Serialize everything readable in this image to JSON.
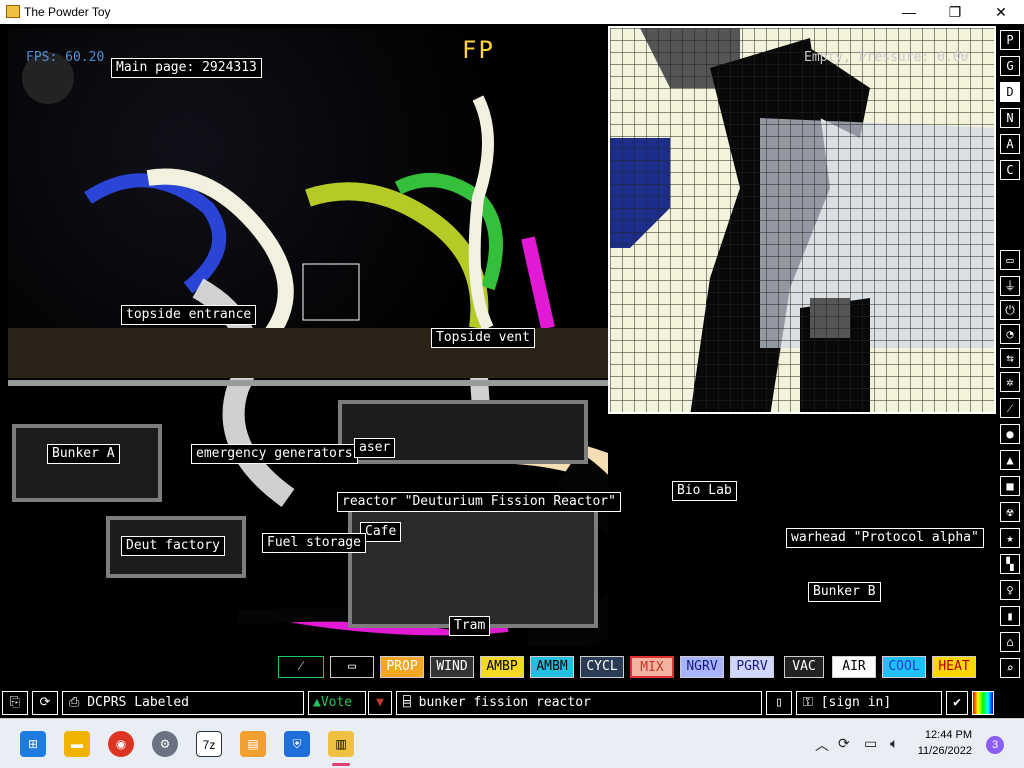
{
  "window": {
    "title": "The Powder Toy",
    "minimize": "—",
    "maximize": "❐",
    "close": "✕"
  },
  "hud": {
    "fps": "FPS: 60.20",
    "hover_info": "Empty, Pressure: 0.00",
    "logo": "FP"
  },
  "labels": {
    "main_page": "Main page: 2924313",
    "topside_entrance": "topside entrance",
    "topside_vent": "Topside vent",
    "bunker_a": "Bunker A",
    "emergency_generators": "emergency generators",
    "laser": "aser",
    "reactor": "reactor \"Deuturium Fission Reactor\"",
    "bio_lab": "Bio Lab",
    "cafe": "Cafe",
    "deut_factory": "Deut factory",
    "fuel_storage": "Fuel storage",
    "warhead": "warhead \"Protocol alpha\"",
    "bunker_b": "Bunker B",
    "tram": "Tram"
  },
  "right_menu": {
    "p": "P",
    "g": "G",
    "d": "D",
    "n": "N",
    "a": "A",
    "c": "C"
  },
  "element_bar": [
    {
      "label": "PROP",
      "bg": "#f5a623",
      "fg": "#ffffff"
    },
    {
      "label": "WIND",
      "bg": "#333333",
      "fg": "#ffffff"
    },
    {
      "label": "AMBP",
      "bg": "#f5d823",
      "fg": "#000000"
    },
    {
      "label": "AMBM",
      "bg": "#22c0e0",
      "fg": "#000000"
    },
    {
      "label": "CYCL",
      "bg": "#2a3b55",
      "fg": "#ffffff"
    },
    {
      "label": "MIX",
      "bg": "#f4b3a0",
      "fg": "#c0392b"
    },
    {
      "label": "NGRV",
      "bg": "#a8b4ff",
      "fg": "#1a1a80"
    },
    {
      "label": "PGRV",
      "bg": "#d0d6ff",
      "fg": "#1a1a80"
    },
    {
      "label": "VAC",
      "bg": "#222222",
      "fg": "#ffffff"
    },
    {
      "label": "AIR",
      "bg": "#ffffff",
      "fg": "#000000"
    },
    {
      "label": "COOL",
      "bg": "#20c0ff",
      "fg": "#1a3fbf"
    },
    {
      "label": "HEAT",
      "bg": "#ffd700",
      "fg": "#b00000"
    }
  ],
  "bottom_bar": {
    "save_name": "DCPRS Labeled",
    "vote": "Vote",
    "tags": "bunker fission reactor",
    "sign_in": "[sign in]"
  },
  "taskbar": {
    "apps": [
      "start",
      "file-explorer",
      "chrome",
      "settings",
      "7zip",
      "photos",
      "defender",
      "powder-toy"
    ],
    "time": "12:44 PM",
    "date": "11/26/2022",
    "notifications": "3"
  },
  "colors": {
    "accent_green": "#22c55e",
    "label_border": "#ffffff",
    "hud_blue": "#4a90d9"
  }
}
